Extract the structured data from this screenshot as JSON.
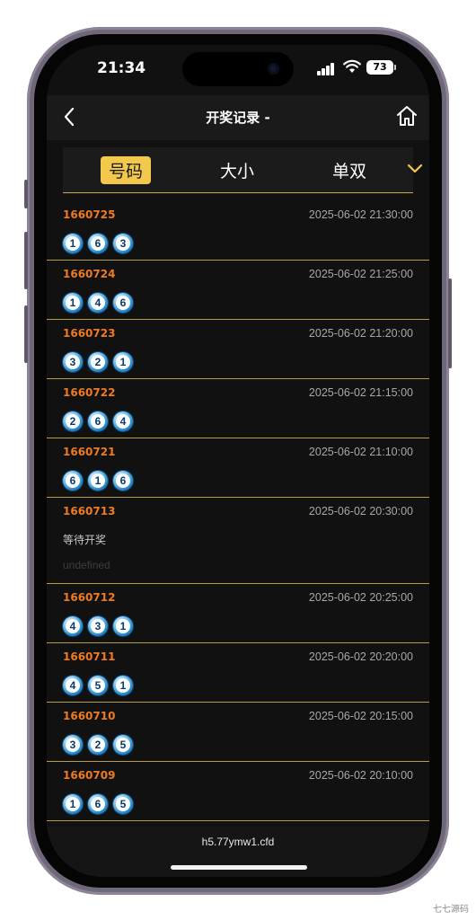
{
  "status_bar": {
    "time": "21:34",
    "battery": "73"
  },
  "header": {
    "title": "开奖记录 -"
  },
  "tabs": [
    {
      "label": "号码",
      "active": true
    },
    {
      "label": "大小",
      "active": false
    },
    {
      "label": "单双",
      "active": false
    }
  ],
  "records": [
    {
      "issue": "1660725",
      "time": "2025-06-02 21:30:00",
      "balls": [
        "1",
        "6",
        "3"
      ]
    },
    {
      "issue": "1660724",
      "time": "2025-06-02 21:25:00",
      "balls": [
        "1",
        "4",
        "6"
      ]
    },
    {
      "issue": "1660723",
      "time": "2025-06-02 21:20:00",
      "balls": [
        "3",
        "2",
        "1"
      ]
    },
    {
      "issue": "1660722",
      "time": "2025-06-02 21:15:00",
      "balls": [
        "2",
        "6",
        "4"
      ]
    },
    {
      "issue": "1660721",
      "time": "2025-06-02 21:10:00",
      "balls": [
        "6",
        "1",
        "6"
      ]
    },
    {
      "issue": "1660713",
      "time": "2025-06-02 20:30:00",
      "pending_text": "等待开奖",
      "undefined_text": "undefined"
    },
    {
      "issue": "1660712",
      "time": "2025-06-02 20:25:00",
      "balls": [
        "4",
        "3",
        "1"
      ]
    },
    {
      "issue": "1660711",
      "time": "2025-06-02 20:20:00",
      "balls": [
        "4",
        "5",
        "1"
      ]
    },
    {
      "issue": "1660710",
      "time": "2025-06-02 20:15:00",
      "balls": [
        "3",
        "2",
        "5"
      ]
    },
    {
      "issue": "1660709",
      "time": "2025-06-02 20:10:00",
      "balls": [
        "1",
        "6",
        "5"
      ]
    }
  ],
  "bottom_bar": {
    "url": "h5.77ymw1.cfd"
  },
  "watermark": "七七源码",
  "colors": {
    "accent": "#f2c94c",
    "issue": "#f07a21",
    "divider": "#b89c46"
  },
  "icons": {
    "back": "chevron-left-icon",
    "home": "home-icon",
    "dropdown": "chevron-down-icon"
  }
}
